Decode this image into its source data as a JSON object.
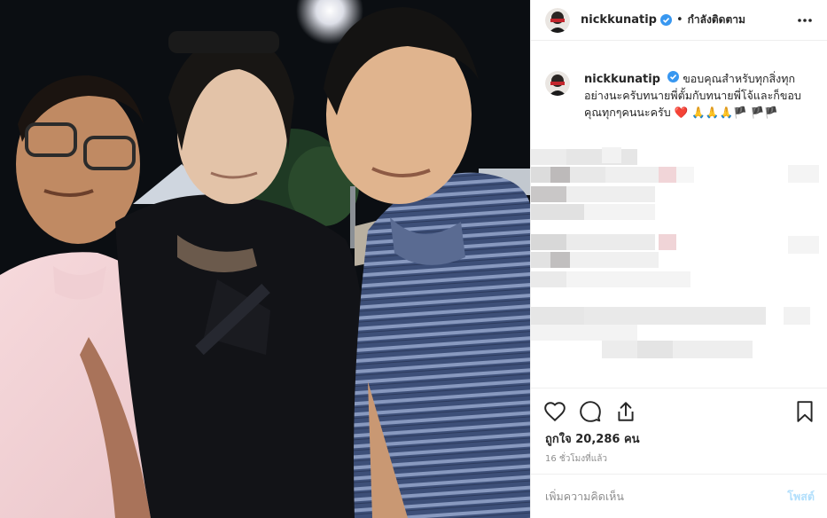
{
  "post": {
    "username": "nickkunatip",
    "follow_state": "กำลังติดตาม",
    "separator": "•",
    "caption_text": "ขอบคุณสำหรับทุกสิ่งทุกอย่างนะครับทนายพี่ตั้มกับทนายพี่โจ้และก็ขอบคุณทุกๆคนนะครับ",
    "caption_emojis": "❤️ 🙏🙏🙏🏴 🏴🏴",
    "likes_label": "ถูกใจ",
    "likes_count": "20,286",
    "likes_unit": "คน",
    "timestamp": "16 ชั่วโมงที่แล้ว"
  },
  "comment_box": {
    "placeholder": "เพิ่มความคิดเห็น",
    "post_label": "โพสต์"
  },
  "icons": {
    "verified": "verified-badge-icon",
    "more": "more-options-icon",
    "like": "heart-icon",
    "comment": "comment-bubble-icon",
    "share": "share-icon",
    "save": "bookmark-icon"
  },
  "colors": {
    "verified_blue": "#3897f0",
    "post_button_disabled": "#b2dffc",
    "heart_red": "#e0245e"
  }
}
